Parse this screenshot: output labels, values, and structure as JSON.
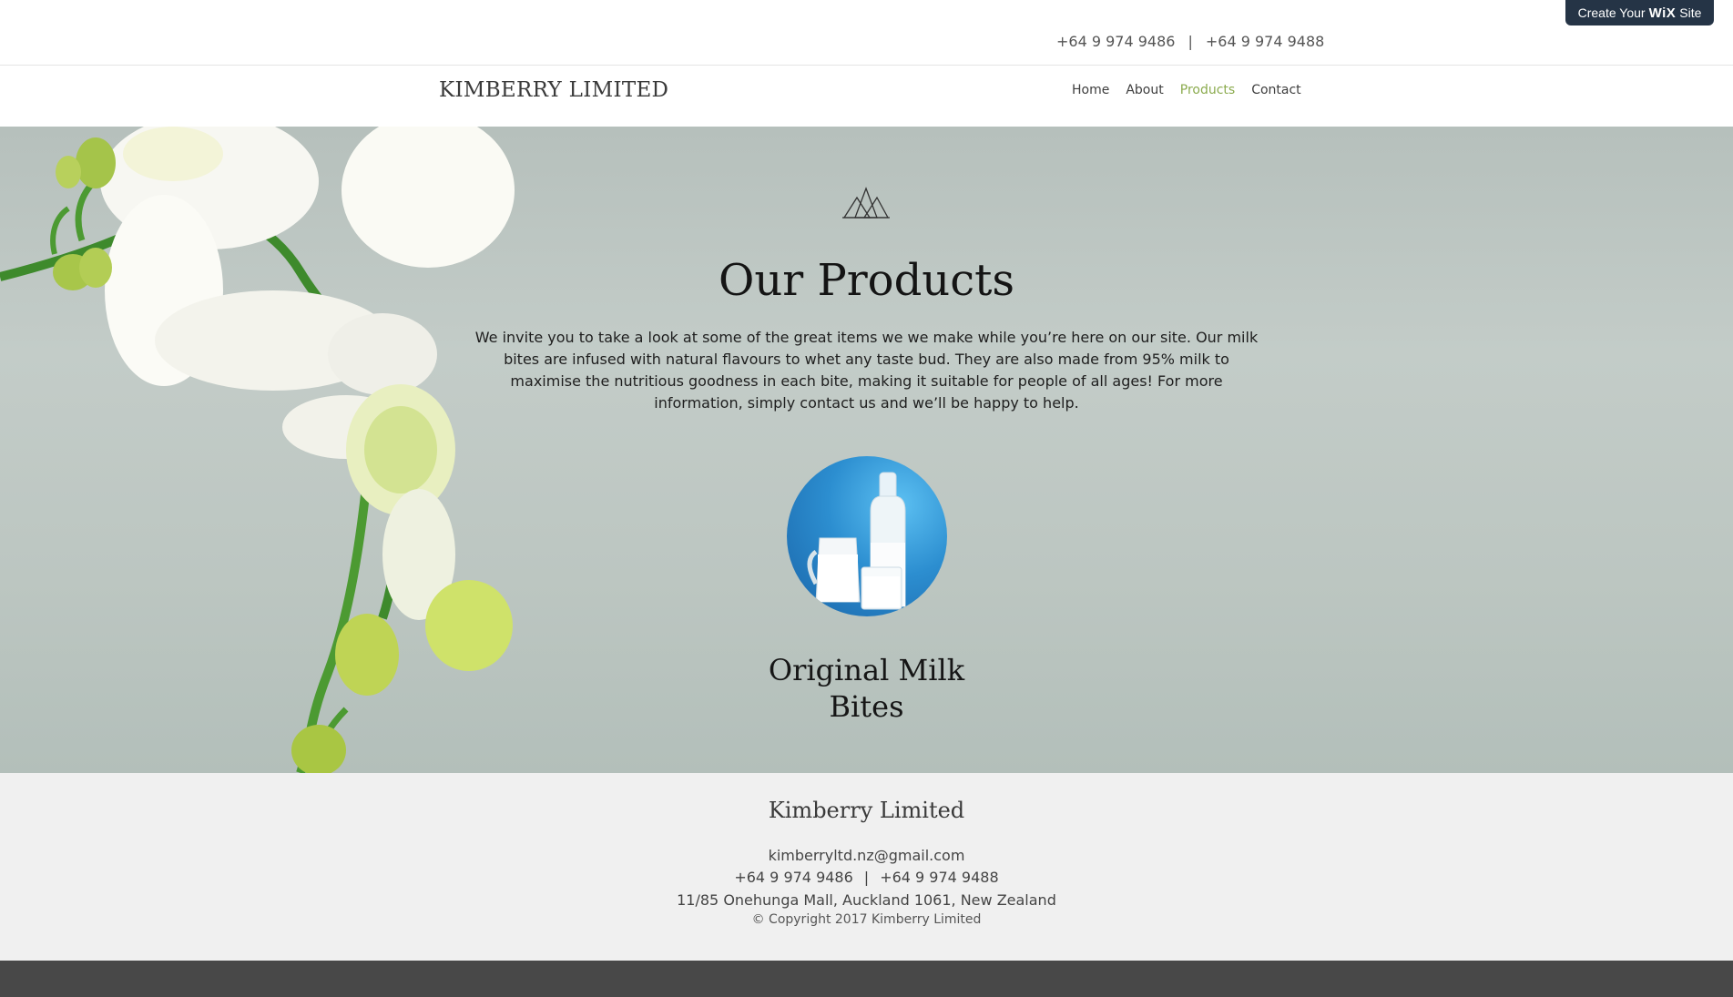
{
  "wix_badge": {
    "prefix": "Create Your",
    "brand": "WiX",
    "suffix": "Site"
  },
  "top_phones": {
    "phone1": "+64 9 974 9486",
    "separator": "|",
    "phone2": "+64 9 974 9488"
  },
  "brand": "KIMBERRY LIMITED",
  "nav": {
    "items": [
      {
        "label": "Home"
      },
      {
        "label": "About"
      },
      {
        "label": "Products",
        "active": true
      },
      {
        "label": "Contact"
      }
    ],
    "active_color": "#8bab4e"
  },
  "hero": {
    "title": "Our Products",
    "intro": "We invite you to take a look at some of the great items we we make while you’re here on our site. Our milk bites are infused with natural flavours to whet any taste bud. They are also made from 95% milk to maximise the nutritious goodness in each bite, making it suitable for people of all ages! For more information, simply contact us and we’ll be happy to help.",
    "product": {
      "name": "Original Milk Bites",
      "image_icon": "milk-bottles-image"
    }
  },
  "footer": {
    "name": "Kimberry Limited",
    "email": "kimberryltd.nz@gmail.com",
    "phone1": "+64 9 974 9486",
    "separator": "|",
    "phone2": "+64 9 974 9488",
    "address": "11/85 Onehunga Mall, Auckland 1061, New Zealand",
    "copyright": "© Copyright 2017 Kimberry Limited"
  },
  "colors": {
    "footer_bg": "#f0f0f0",
    "bottom_strip": "#484848",
    "badge_bg": "#253446"
  }
}
